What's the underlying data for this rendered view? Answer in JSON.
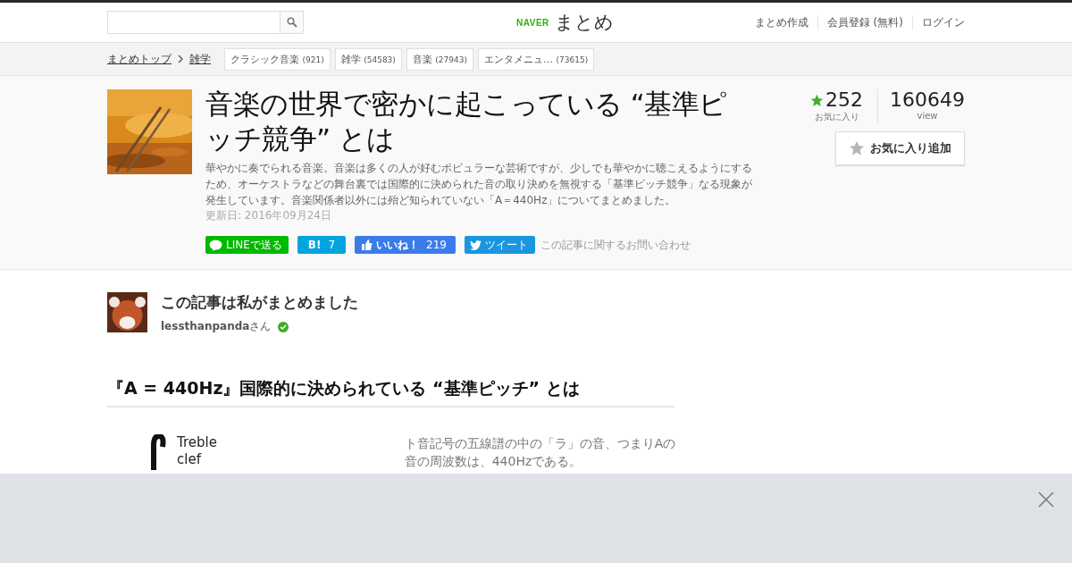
{
  "header": {
    "logo": {
      "brand": "NAVER",
      "name": "まとめ"
    },
    "links": [
      "まとめ作成",
      "会員登録 (無料)",
      "ログイン"
    ]
  },
  "breadcrumb": {
    "items": [
      "まとめトップ",
      "雑学"
    ],
    "tags": [
      {
        "label": "クラシック音楽",
        "count": "(921)"
      },
      {
        "label": "雑学",
        "count": "(54583)"
      },
      {
        "label": "音楽",
        "count": "(27943)"
      },
      {
        "label": "エンタメニュ…",
        "count": "(73615)"
      }
    ]
  },
  "article": {
    "title": "音楽の世界で密かに起こっている “基準ピッチ競争” とは",
    "description": "華やかに奏でられる音楽。音楽は多くの人が好むポピュラーな芸術ですが、少しでも華やかに聴こえるようにするため、オーケストラなどの舞台裏では国際的に決められた音の取り決めを無視する「基準ピッチ競争」なる現象が発生しています。音楽関係者以外には殆ど知られていない「A＝440Hz」についてまとめました。",
    "updated": "更新日: 2016年09月24日",
    "share": [
      {
        "kind": "line",
        "label": "LINEで送る"
      },
      {
        "kind": "hatena",
        "label": "B!",
        "count": "7"
      },
      {
        "kind": "facebook",
        "label": "いいね！",
        "count": "219"
      },
      {
        "kind": "twitter",
        "label": "ツイート"
      }
    ],
    "contact": "この記事に関するお問い合わせ"
  },
  "stats": {
    "favorites": "252",
    "favorites_label": "お気に入り",
    "views": "160649",
    "views_label": "view",
    "add_button": "お気に入り追加"
  },
  "author": {
    "heading": "この記事は私がまとめました",
    "name": "lessthanpanda",
    "suffix": "さん",
    "verified": true
  },
  "section": {
    "heading": "『A = 440Hz』国際的に決められている “基準ピッチ” とは",
    "figure_labels": [
      "Treble",
      "clef"
    ],
    "text": "ト音記号の五線譜の中の「ラ」の音、つまりAの音の周波数は、440Hzである。"
  },
  "ad_banner": {
    "closable": true
  }
}
